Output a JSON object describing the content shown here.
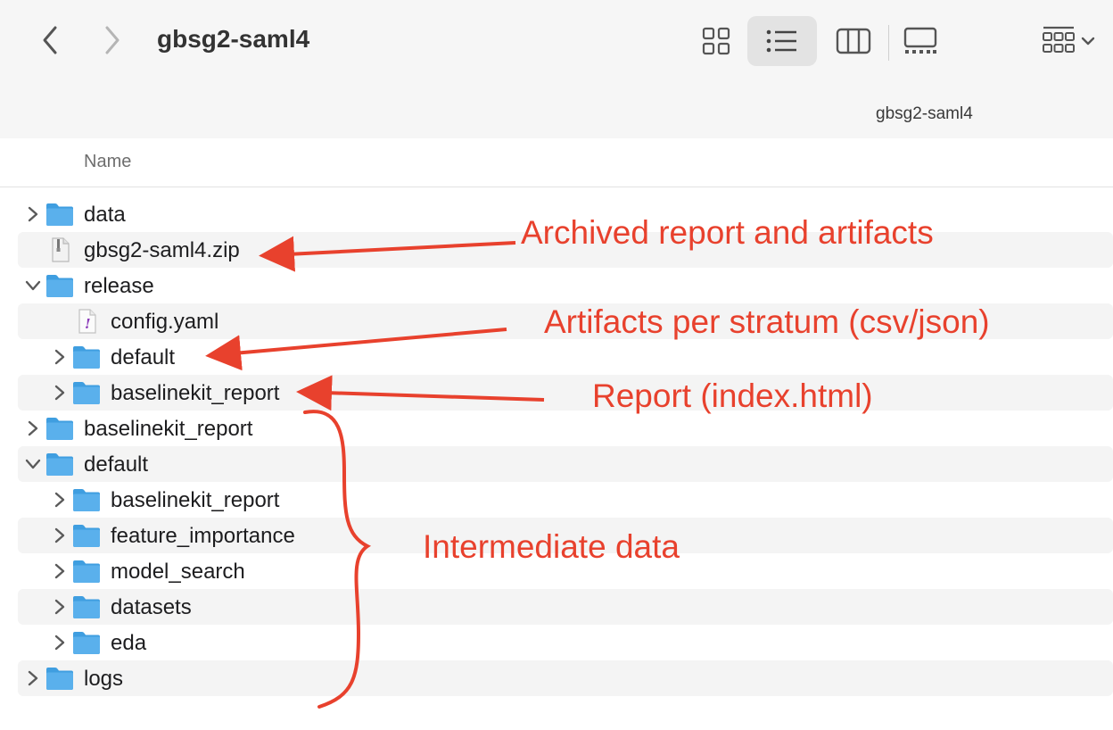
{
  "toolbar": {
    "title": "gbsg2-saml4",
    "path_label": "gbsg2-saml4",
    "back_icon": "chevron-left-icon",
    "forward_icon": "chevron-right-icon",
    "view_modes": [
      "icons",
      "list",
      "columns",
      "gallery"
    ],
    "active_view": "list"
  },
  "columns": {
    "name": "Name"
  },
  "files": [
    {
      "name": "data",
      "type": "folder",
      "indent": 0,
      "expanded": false
    },
    {
      "name": "gbsg2-saml4.zip",
      "type": "zip",
      "indent": 0,
      "expanded": null
    },
    {
      "name": "release",
      "type": "folder",
      "indent": 0,
      "expanded": true
    },
    {
      "name": "config.yaml",
      "type": "yaml",
      "indent": 1,
      "expanded": null
    },
    {
      "name": "default",
      "type": "folder",
      "indent": 1,
      "expanded": false
    },
    {
      "name": "baselinekit_report",
      "type": "folder",
      "indent": 1,
      "expanded": false
    },
    {
      "name": "baselinekit_report",
      "type": "folder",
      "indent": 0,
      "expanded": false
    },
    {
      "name": "default",
      "type": "folder",
      "indent": 0,
      "expanded": true
    },
    {
      "name": "baselinekit_report",
      "type": "folder",
      "indent": 1,
      "expanded": false
    },
    {
      "name": "feature_importance",
      "type": "folder",
      "indent": 1,
      "expanded": false
    },
    {
      "name": "model_search",
      "type": "folder",
      "indent": 1,
      "expanded": false
    },
    {
      "name": "datasets",
      "type": "folder",
      "indent": 1,
      "expanded": false
    },
    {
      "name": "eda",
      "type": "folder",
      "indent": 1,
      "expanded": false
    },
    {
      "name": "logs",
      "type": "folder",
      "indent": 0,
      "expanded": false
    }
  ],
  "annotations": {
    "archived": "Archived report and artifacts",
    "artifacts": "Artifacts per stratum (csv/json)",
    "report": "Report (index.html)",
    "intermediate": "Intermediate data"
  },
  "colors": {
    "annotation": "#e8412d",
    "folder": "#5ab0ec",
    "yaml_mark": "#8a3ab9"
  }
}
